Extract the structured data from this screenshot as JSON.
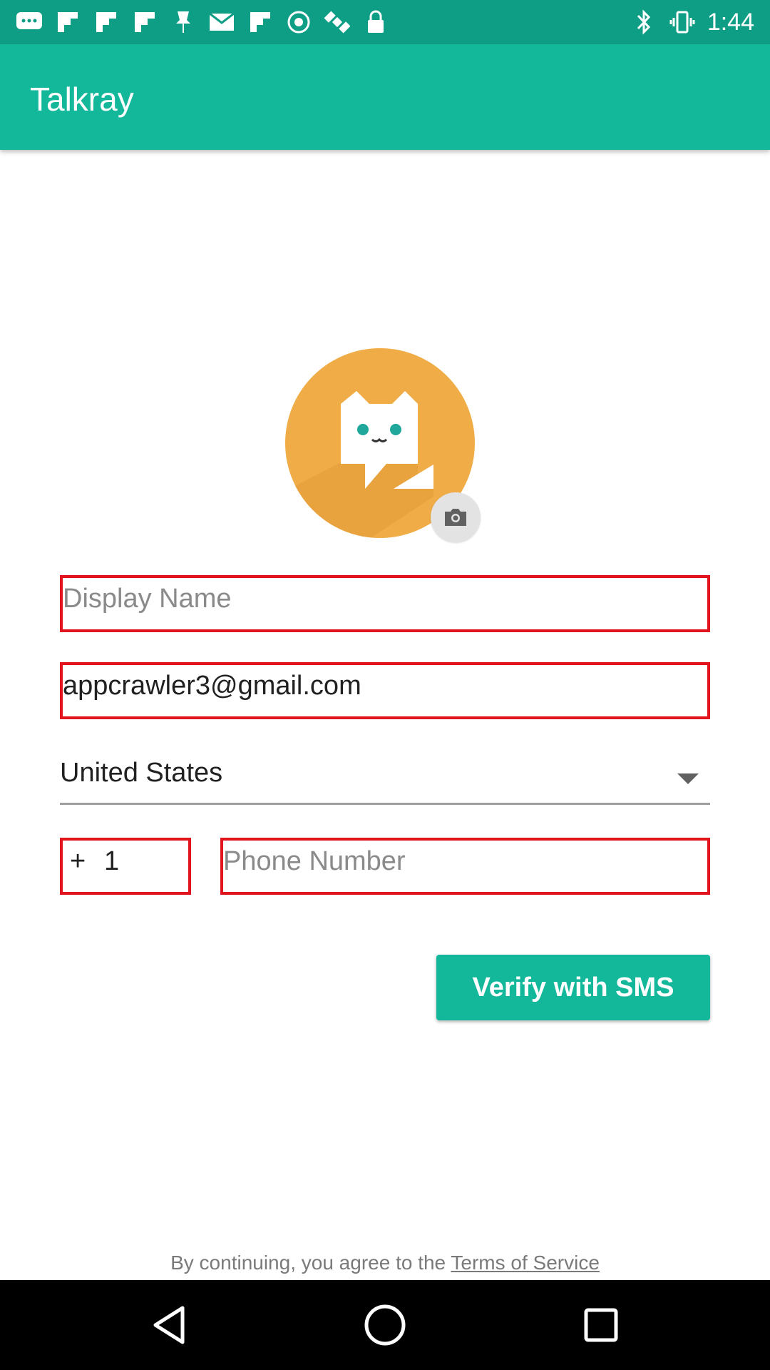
{
  "status_bar": {
    "time": "1:44",
    "left_icons": [
      "messages-icon",
      "flipboard-icon",
      "flipboard-icon",
      "flipboard-icon",
      "pin-icon",
      "mail-icon",
      "flipboard-icon",
      "fake-gps-icon",
      "satellite-icon",
      "lock-icon"
    ],
    "right_icons": [
      "bluetooth-icon",
      "vibrate-icon"
    ]
  },
  "app_bar": {
    "title": "Talkray"
  },
  "avatar": {
    "icon": "talkray-cat-logo",
    "badge_icon": "camera-icon"
  },
  "form": {
    "display_name": {
      "value": "",
      "placeholder": "Display Name"
    },
    "email": {
      "value": "appcrawler3@gmail.com",
      "placeholder": ""
    },
    "country": {
      "selected": "United States"
    },
    "country_code": {
      "prefix": "+",
      "value": "1"
    },
    "phone": {
      "value": "",
      "placeholder": "Phone Number"
    }
  },
  "verify_button": {
    "label": "Verify with SMS"
  },
  "terms": {
    "prefix": "By continuing, you agree to the ",
    "link": "Terms of Service"
  },
  "nav_bar": {
    "buttons": [
      "back-icon",
      "home-icon",
      "recent-apps-icon"
    ]
  },
  "colors": {
    "status_bar": "#0e9e86",
    "app_bar": "#13b89a",
    "accent": "#13b89a",
    "avatar": "#f0ad47",
    "field_border": "#e0141c"
  }
}
